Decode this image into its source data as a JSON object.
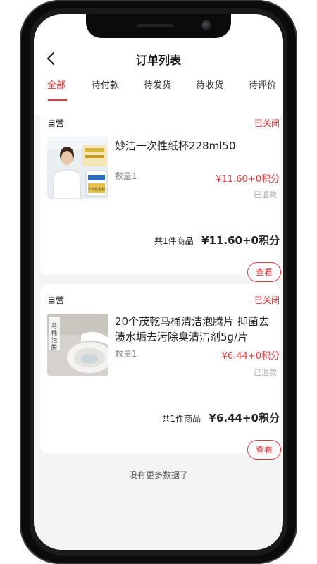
{
  "header": {
    "title": "订单列表",
    "back_icon": "chevron-left-icon"
  },
  "tabs": [
    {
      "label": "全部",
      "active": true
    },
    {
      "label": "待付款",
      "active": false
    },
    {
      "label": "待发货",
      "active": false
    },
    {
      "label": "待收货",
      "active": false
    },
    {
      "label": "待评价",
      "active": false
    }
  ],
  "orders": [
    {
      "shop": "自营",
      "status": "已关闭",
      "product_name": "妙洁一次性纸杯228ml50",
      "thumbnail_text": "一次性纸杯",
      "quantity": "数量1",
      "price": "¥11.60+0积分",
      "refund_status": "已退款",
      "summary_label": "共1件商品",
      "summary_total": "¥11.60+0积分",
      "view_button": "查看"
    },
    {
      "shop": "自营",
      "status": "已关闭",
      "product_name": "20个茂乾马桶清洁泡腾片 抑菌去渍水垢去污除臭清洁剂5g/片",
      "thumbnail_text": "马桶泡腾片",
      "quantity": "数量1",
      "price": "¥6.44+0积分",
      "refund_status": "已退款",
      "summary_label": "共1件商品",
      "summary_total": "¥6.44+0积分",
      "view_button": "查看"
    }
  ],
  "footer_note": "没有更多数据了",
  "colors": {
    "accent": "#e4393c",
    "background": "#f4f4f4"
  }
}
